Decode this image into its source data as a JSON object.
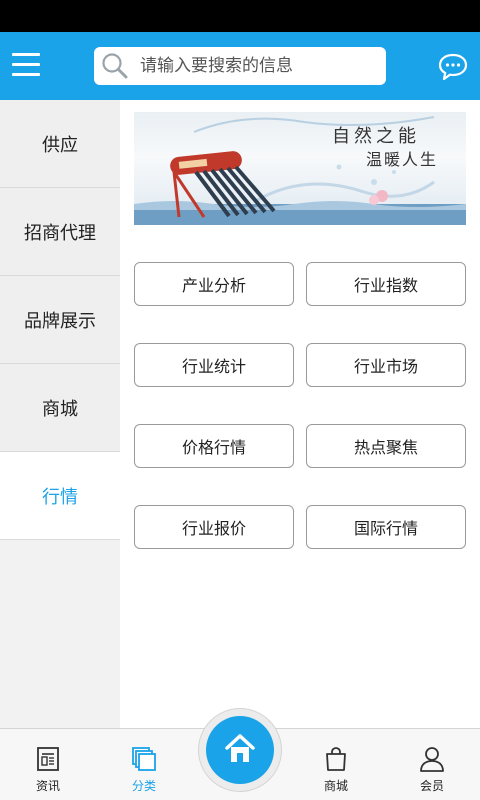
{
  "header": {
    "search_placeholder": "请输入要搜索的信息"
  },
  "sidebar": {
    "items": [
      {
        "label": "供应",
        "active": false
      },
      {
        "label": "招商代理",
        "active": false
      },
      {
        "label": "品牌展示",
        "active": false
      },
      {
        "label": "商城",
        "active": false
      },
      {
        "label": "行情",
        "active": true
      }
    ]
  },
  "banner": {
    "title": "自然之能",
    "subtitle": "温暖人生"
  },
  "categories": [
    "产业分析",
    "行业指数",
    "行业统计",
    "行业市场",
    "价格行情",
    "热点聚焦",
    "行业报价",
    "国际行情"
  ],
  "tabbar": {
    "items": [
      {
        "label": "资讯",
        "icon": "news-icon",
        "active": false
      },
      {
        "label": "分类",
        "icon": "category-icon",
        "active": true
      },
      {
        "label": "",
        "icon": "home-icon",
        "active": false
      },
      {
        "label": "商城",
        "icon": "shopping-bag-icon",
        "active": false
      },
      {
        "label": "会员",
        "icon": "user-icon",
        "active": false
      }
    ]
  },
  "colors": {
    "accent": "#1aa3e8",
    "status_bar": "#000000",
    "sidebar_bg": "#efefef"
  }
}
